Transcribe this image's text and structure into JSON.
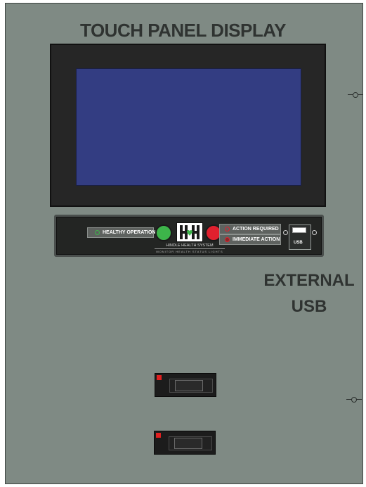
{
  "title": "TOUCH PANEL DISPLAY",
  "status_panel": {
    "healthy_label": "HEALTHY OPERATION",
    "action_required_label": "ACTION REQUIRED",
    "immediate_action_label": "IMMEDIATE ACTION",
    "logo_letters": "HH",
    "logo_name": "HINDLE HEALTH SYSTEM",
    "logo_tagline": "MONITOR HEALTH STATUS LIGHTS",
    "usb_label": "USB"
  },
  "external_usb": {
    "line1": "EXTERNAL",
    "line2": "USB"
  },
  "colors": {
    "panel": "#7f8a84",
    "screen": "#333d82",
    "healthy": "#3db54a",
    "alarm": "#e0202e"
  }
}
